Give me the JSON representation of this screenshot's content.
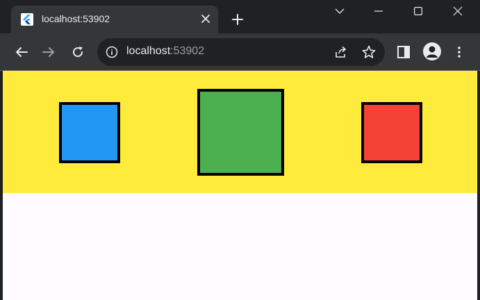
{
  "browser": {
    "tab": {
      "title": "localhost:53902",
      "favicon": "flutter-logo"
    },
    "icons": {
      "close_tab": "close-icon",
      "new_tab": "plus-icon",
      "tab_search": "chevron-down-icon",
      "minimize": "minimize-icon",
      "maximize": "maximize-icon",
      "close_window": "close-icon",
      "back": "arrow-left-icon",
      "forward": "arrow-right-icon",
      "reload": "reload-icon",
      "site_info": "info-icon",
      "share": "share-icon",
      "bookmark": "star-icon",
      "side_panel": "side-panel-icon",
      "profile": "profile-icon",
      "menu": "kebab-menu-icon"
    },
    "address_bar": {
      "host": "localhost",
      "port": ":53902"
    }
  },
  "page": {
    "banner_color": "#ffeb3b",
    "background_color": "#fffbfe",
    "boxes": [
      {
        "name": "blue",
        "color": "#2196f3"
      },
      {
        "name": "green",
        "color": "#4caf50"
      },
      {
        "name": "red",
        "color": "#f44336"
      }
    ]
  },
  "colors": {
    "tabstrip": "#202124",
    "toolbar": "#35363a",
    "icon": "#e8eaed",
    "icon_disabled": "#9aa0a6"
  }
}
